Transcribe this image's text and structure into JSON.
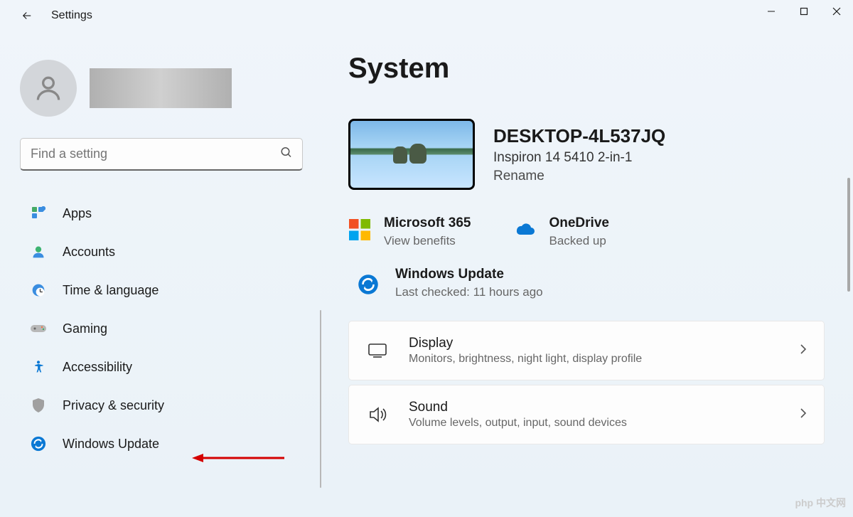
{
  "app": {
    "title": "Settings"
  },
  "search": {
    "placeholder": "Find a setting"
  },
  "sidebar": {
    "items": [
      {
        "label": "Apps"
      },
      {
        "label": "Accounts"
      },
      {
        "label": "Time & language"
      },
      {
        "label": "Gaming"
      },
      {
        "label": "Accessibility"
      },
      {
        "label": "Privacy & security"
      },
      {
        "label": "Windows Update"
      }
    ]
  },
  "page": {
    "title": "System"
  },
  "device": {
    "name": "DESKTOP-4L537JQ",
    "model": "Inspiron 14 5410 2-in-1",
    "rename": "Rename"
  },
  "status": {
    "m365": {
      "title": "Microsoft 365",
      "sub": "View benefits"
    },
    "onedrive": {
      "title": "OneDrive",
      "sub": "Backed up"
    },
    "winupdate": {
      "title": "Windows Update",
      "sub": "Last checked: 11 hours ago"
    }
  },
  "settings": [
    {
      "title": "Display",
      "sub": "Monitors, brightness, night light, display profile"
    },
    {
      "title": "Sound",
      "sub": "Volume levels, output, input, sound devices"
    }
  ],
  "watermark": "php 中文网"
}
